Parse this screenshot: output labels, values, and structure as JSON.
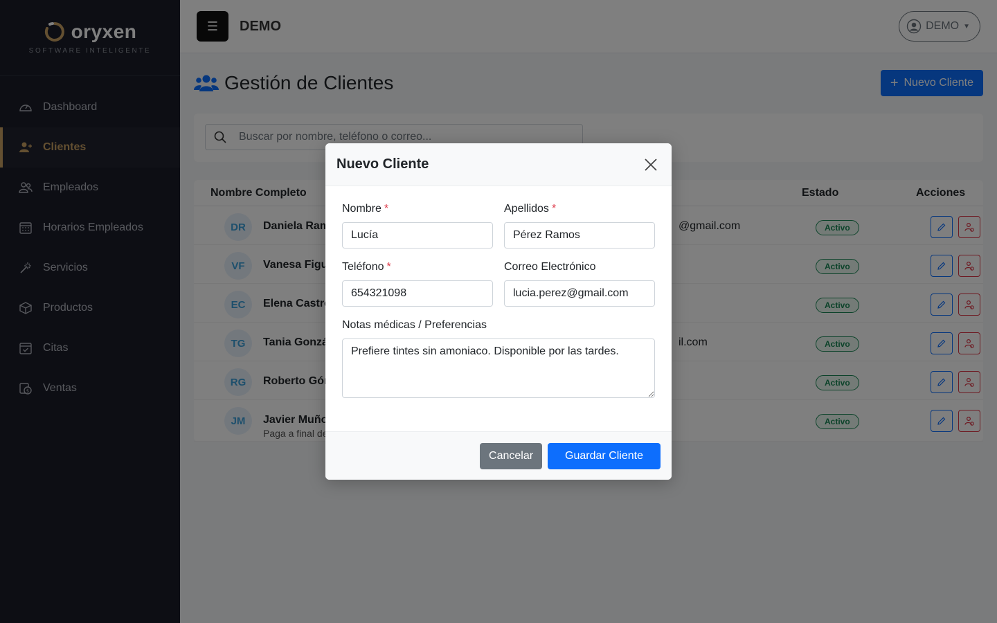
{
  "brand": {
    "name": "oryxen",
    "tagline": "SOFTWARE INTELIGENTE",
    "accent": "#c9a063"
  },
  "sidebar": {
    "items": [
      {
        "label": "Dashboard",
        "icon": "gauge-icon",
        "active": false
      },
      {
        "label": "Clientes",
        "icon": "users-icon",
        "active": true
      },
      {
        "label": "Empleados",
        "icon": "people-icon",
        "active": false
      },
      {
        "label": "Horarios Empleados",
        "icon": "calendar-grid-icon",
        "active": false
      },
      {
        "label": "Servicios",
        "icon": "magic-wand-icon",
        "active": false
      },
      {
        "label": "Productos",
        "icon": "box-icon",
        "active": false
      },
      {
        "label": "Citas",
        "icon": "calendar-check-icon",
        "active": false
      },
      {
        "label": "Ventas",
        "icon": "cash-icon",
        "active": false
      }
    ]
  },
  "topbar": {
    "title": "DEMO",
    "user": "DEMO"
  },
  "page": {
    "title": "Gestión de Clientes",
    "new_button": "Nuevo Cliente"
  },
  "search": {
    "placeholder": "Buscar por nombre, teléfono o correo..."
  },
  "table": {
    "headers": {
      "name": "Nombre Completo",
      "status": "Estado",
      "actions": "Acciones"
    },
    "rows": [
      {
        "initials": "DR",
        "name": "Daniela Ramos",
        "email_tail": "@gmail.com",
        "status": "Activo"
      },
      {
        "initials": "VF",
        "name": "Vanesa Figuei",
        "email_tail": "",
        "status": "Activo"
      },
      {
        "initials": "EC",
        "name": "Elena Castro",
        "email_tail": "",
        "status": "Activo"
      },
      {
        "initials": "TG",
        "name": "Tania Gonzále",
        "email_tail": "il.com",
        "status": "Activo"
      },
      {
        "initials": "RG",
        "name": "Roberto Góme",
        "email_tail": "",
        "status": "Activo"
      },
      {
        "initials": "JM",
        "name": "Javier Muñoz",
        "note": "Paga a final de m",
        "email_tail": "",
        "status": "Activo"
      }
    ]
  },
  "modal": {
    "title": "Nuevo Cliente",
    "fields": {
      "nombre": {
        "label": "Nombre",
        "required": "*",
        "value": "Lucía"
      },
      "apellidos": {
        "label": "Apellidos",
        "required": "*",
        "value": "Pérez Ramos"
      },
      "telefono": {
        "label": "Teléfono",
        "required": "*",
        "value": "654321098"
      },
      "correo": {
        "label": "Correo Electrónico",
        "value": "lucia.perez@gmail.com"
      },
      "notas": {
        "label": "Notas médicas / Preferencias",
        "value": "Prefiere tintes sin amoniaco. Disponible por las tardes."
      }
    },
    "cancel_label": "Cancelar",
    "save_label": "Guardar Cliente"
  }
}
